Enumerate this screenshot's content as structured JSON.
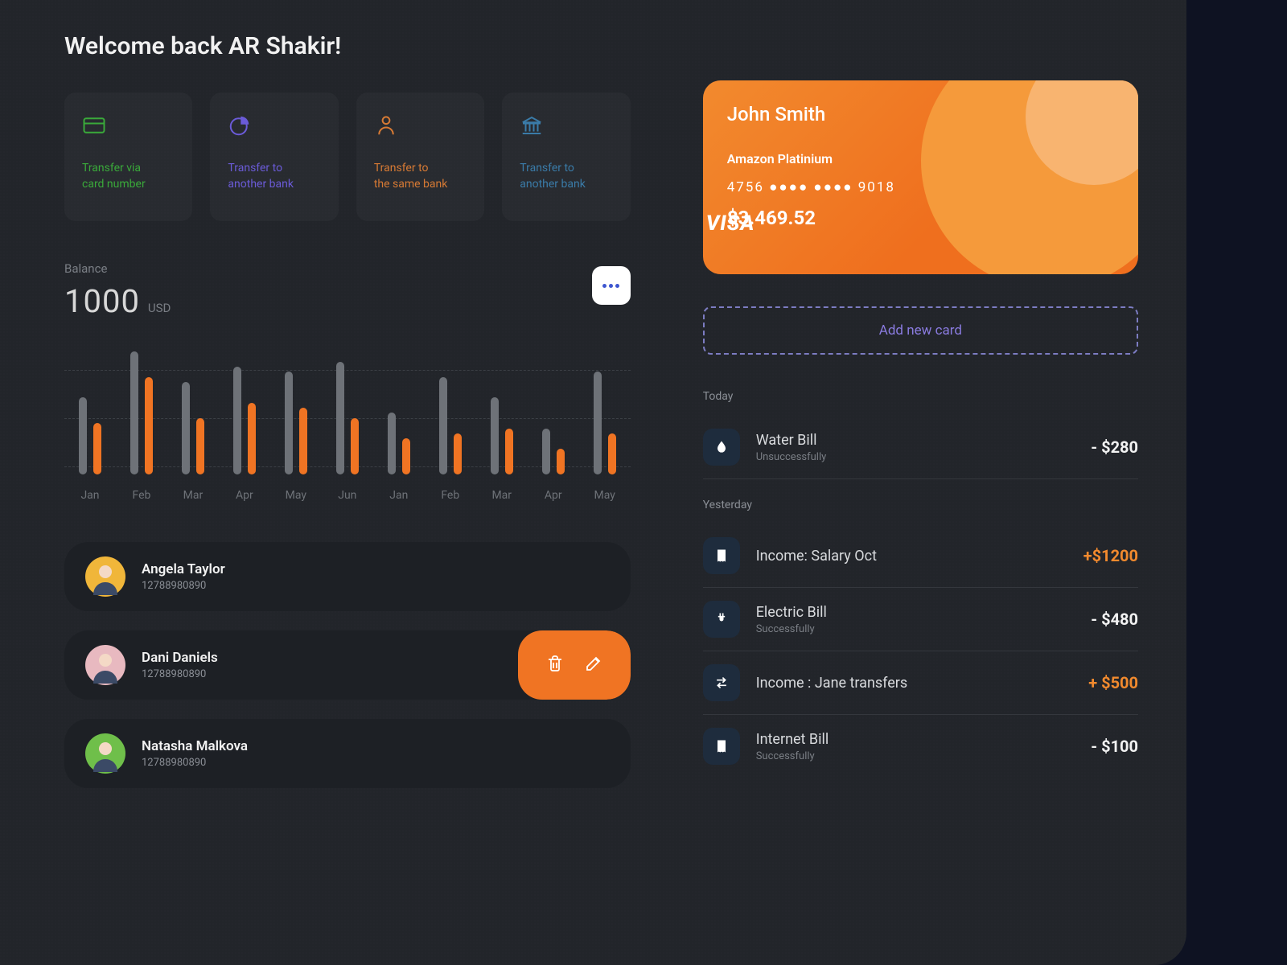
{
  "welcome": "Welcome back AR Shakir!",
  "actions": [
    {
      "label": "Transfer via\ncard number",
      "color": "c-green",
      "icon": "credit-card-icon"
    },
    {
      "label": "Transfer to\nanother bank",
      "color": "c-purple",
      "icon": "pie-chart-icon"
    },
    {
      "label": "Transfer to\nthe same bank",
      "color": "c-orange",
      "icon": "person-icon"
    },
    {
      "label": "Transfer to\nanother bank",
      "color": "c-blue",
      "icon": "bank-icon"
    }
  ],
  "balance": {
    "label": "Balance",
    "value": "1000",
    "currency": "USD"
  },
  "chart_data": {
    "type": "bar",
    "categories": [
      "Jan",
      "Feb",
      "Mar",
      "Apr",
      "May",
      "Jun",
      "Jan",
      "Feb",
      "Mar",
      "Apr",
      "May"
    ],
    "series": [
      {
        "name": "gray",
        "values": [
          75,
          120,
          90,
          105,
          100,
          110,
          60,
          95,
          75,
          45,
          100
        ]
      },
      {
        "name": "orange",
        "values": [
          50,
          95,
          55,
          70,
          65,
          55,
          35,
          40,
          45,
          25,
          40
        ]
      }
    ],
    "grid_y_positions_pct": [
      18,
      48,
      78
    ]
  },
  "more_button_icon": "more-icon",
  "contacts": [
    {
      "name": "Angela Taylor",
      "number": "12788980890",
      "avatar_bg": "#f0b63a",
      "swipe": false
    },
    {
      "name": "Dani Daniels",
      "number": "12788980890",
      "avatar_bg": "#e8b9c0",
      "swipe": true
    },
    {
      "name": "Natasha Malkova",
      "number": "12788980890",
      "avatar_bg": "#6fbf4a",
      "swipe": false
    }
  ],
  "card": {
    "holder": "John Smith",
    "brand": "Amazon Platinium",
    "number": "4756   ●●●●  ●●●●   9018",
    "balance": "$3.469.52",
    "network": "VISA"
  },
  "add_card_label": "Add new card",
  "transactions": {
    "groups": [
      {
        "label": "Today",
        "items": [
          {
            "title": "Water Bill",
            "subtitle": "Unsuccessfully",
            "amount": "- $280",
            "sign": "neg",
            "icon": "water-drop-icon"
          }
        ]
      },
      {
        "label": "Yesterday",
        "items": [
          {
            "title": "Income: Salary Oct",
            "subtitle": "",
            "amount": "+$1200",
            "sign": "pos",
            "icon": "receipt-icon"
          },
          {
            "title": "Electric Bill",
            "subtitle": "Successfully",
            "amount": "- $480",
            "sign": "neg",
            "icon": "plug-icon"
          },
          {
            "title": "Income : Jane transfers",
            "subtitle": "",
            "amount": "+ $500",
            "sign": "pos",
            "icon": "transfer-icon"
          },
          {
            "title": "Internet Bill",
            "subtitle": "Successfully",
            "amount": "- $100",
            "sign": "neg",
            "icon": "receipt-icon"
          }
        ]
      }
    ]
  }
}
